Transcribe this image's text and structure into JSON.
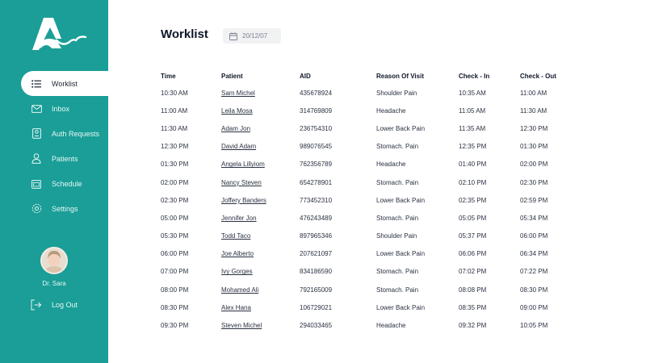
{
  "sidebar": {
    "nav": [
      {
        "label": "Worklist",
        "icon": "list-icon",
        "active": true
      },
      {
        "label": "Inbox",
        "icon": "envelope-icon"
      },
      {
        "label": "Auth Requests",
        "icon": "auth-requests-icon"
      },
      {
        "label": "Patients",
        "icon": "patient-icon"
      },
      {
        "label": "Schedule",
        "icon": "schedule-icon"
      },
      {
        "label": "Settings",
        "icon": "gear-icon"
      }
    ],
    "user_name": "Dr. Sara",
    "logout_label": "Log Out"
  },
  "header": {
    "title": "Worklist",
    "date": "20/12/07"
  },
  "table": {
    "columns": [
      "Time",
      "Patient",
      "AID",
      "Reason Of Visit",
      "Check - In",
      "Check - Out"
    ],
    "rows": [
      {
        "time": "10:30 AM",
        "patient": "Sam Michel",
        "aid": "435678924",
        "reason": "Shoulder Pain",
        "check_in": "10:35 AM",
        "check_out": "11:00 AM"
      },
      {
        "time": "11:00 AM",
        "patient": "Leila Mosa",
        "aid": "314769809",
        "reason": "Headache",
        "check_in": "11:05 AM",
        "check_out": "11:30 AM"
      },
      {
        "time": "11:30 AM",
        "patient": "Adam Jon",
        "aid": "236754310",
        "reason": "Lower  Back Pain",
        "check_in": "11:35 AM",
        "check_out": "12:30 PM"
      },
      {
        "time": "12:30 PM",
        "patient": "David Adam",
        "aid": "989076545",
        "reason": "Stomach. Pain",
        "check_in": "12:35 PM",
        "check_out": "01:30 PM"
      },
      {
        "time": "01:30 PM",
        "patient": "Angela Lillyiom",
        "aid": "762356789",
        "reason": "Headache",
        "check_in": "01:40 PM",
        "check_out": "02:00 PM"
      },
      {
        "time": "02:00 PM",
        "patient": "Nancy Steven",
        "aid": "654278901",
        "reason": "Stomach. Pain",
        "check_in": "02:10 PM",
        "check_out": "02:30 PM"
      },
      {
        "time": "02:30 PM",
        "patient": "Joffery Banders",
        "aid": "773452310",
        "reason": "Lower  Back Pain",
        "check_in": "02:35 PM",
        "check_out": "02:59 PM"
      },
      {
        "time": "05:00 PM",
        "patient": "Jennifer Jon",
        "aid": "476243489",
        "reason": "Stomach. Pain",
        "check_in": "05:05 PM",
        "check_out": "05:34 PM"
      },
      {
        "time": "05:30 PM",
        "patient": "Todd Taco",
        "aid": "897965346",
        "reason": "Shoulder Pain",
        "check_in": "05:37 PM",
        "check_out": "06:00 PM"
      },
      {
        "time": "06:00 PM",
        "patient": "Joe Alberto",
        "aid": "207621097",
        "reason": "Lower  Back Pain",
        "check_in": "06:06 PM",
        "check_out": "06:34 PM"
      },
      {
        "time": "07:00 PM",
        "patient": "Ivy Gorges",
        "aid": "834186590",
        "reason": "Stomach. Pain",
        "check_in": "07:02 PM",
        "check_out": "07:22 PM"
      },
      {
        "time": "08:00 PM",
        "patient": "Mohamed Ali",
        "aid": "792165009",
        "reason": "Stomach. Pain",
        "check_in": "08:08 PM",
        "check_out": "08:30 PM"
      },
      {
        "time": "08:30 PM",
        "patient": "Alex Hana",
        "aid": "106729021",
        "reason": "Lower  Back Pain",
        "check_in": "08:35 PM",
        "check_out": "09:00 PM"
      },
      {
        "time": "09:30 PM",
        "patient": "Steven Michel",
        "aid": "294033465",
        "reason": "Headache",
        "check_in": "09:32 PM",
        "check_out": "10:05 PM"
      }
    ]
  },
  "colors": {
    "brand": "#1a9e97",
    "sidebar_text": "#e6f7f6",
    "title": "#0f1628"
  }
}
